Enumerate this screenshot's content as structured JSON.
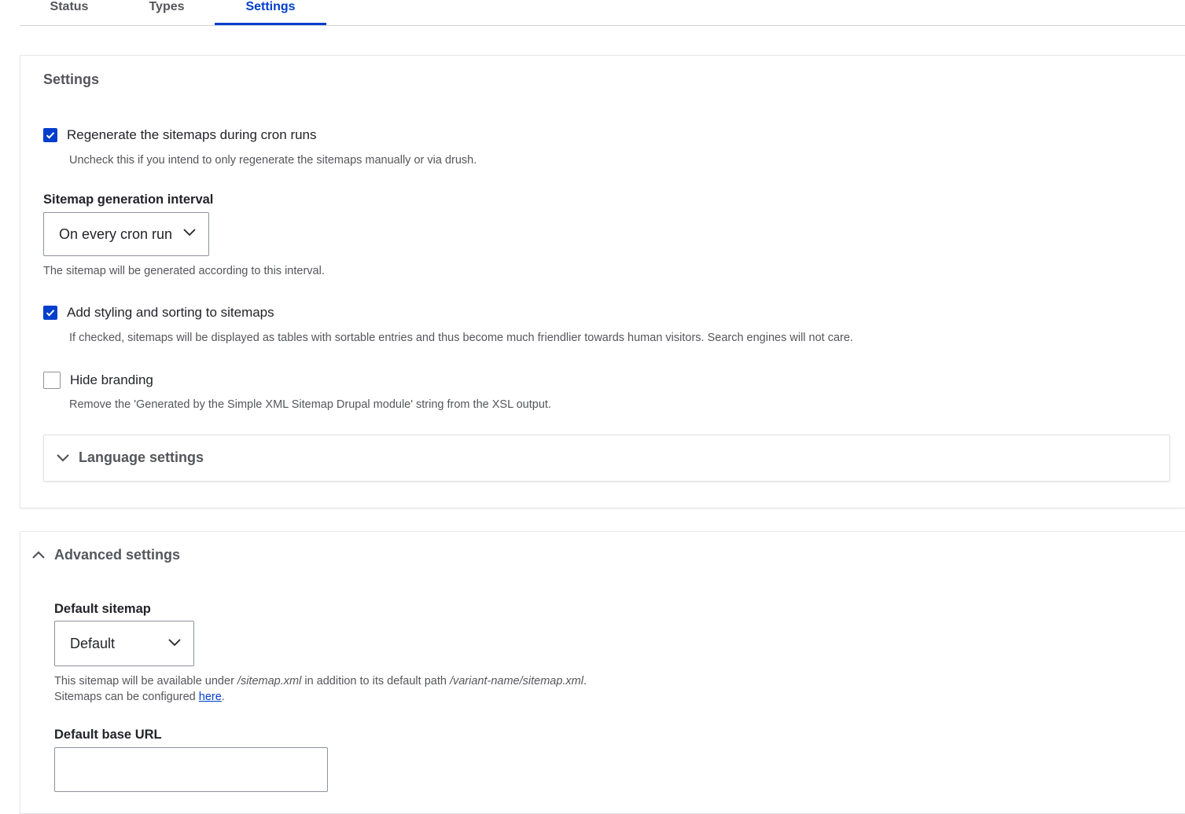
{
  "tabs": [
    {
      "label": "Status",
      "active": false
    },
    {
      "label": "Types",
      "active": false
    },
    {
      "label": "Settings",
      "active": true
    }
  ],
  "settings": {
    "title": "Settings",
    "regenerate": {
      "checked": true,
      "label": "Regenerate the sitemaps during cron runs",
      "description": "Uncheck this if you intend to only regenerate the sitemaps manually or via drush."
    },
    "interval": {
      "label": "Sitemap generation interval",
      "value": "On every cron run",
      "description": "The sitemap will be generated according to this interval."
    },
    "styling": {
      "checked": true,
      "label": "Add styling and sorting to sitemaps",
      "description": "If checked, sitemaps will be displayed as tables with sortable entries and thus become much friendlier towards human visitors. Search engines will not care."
    },
    "branding": {
      "checked": false,
      "label": "Hide branding",
      "description": "Remove the 'Generated by the Simple XML Sitemap Drupal module' string from the XSL output."
    },
    "language_settings": "Language settings"
  },
  "advanced": {
    "title": "Advanced settings",
    "default_sitemap": {
      "label": "Default sitemap",
      "value": "Default",
      "desc_part1": "This sitemap will be available under ",
      "desc_path1": "/sitemap.xml",
      "desc_part2": " in addition to its default path ",
      "desc_path2": "/variant-name/sitemap.xml",
      "desc_part3": ".",
      "desc_line2": "Sitemaps can be configured ",
      "desc_link": "here",
      "desc_line2_end": "."
    },
    "base_url": {
      "label": "Default base URL",
      "value": ""
    }
  },
  "colors": {
    "accent": "#003ecc",
    "text": "#232429",
    "muted": "#55565b"
  }
}
